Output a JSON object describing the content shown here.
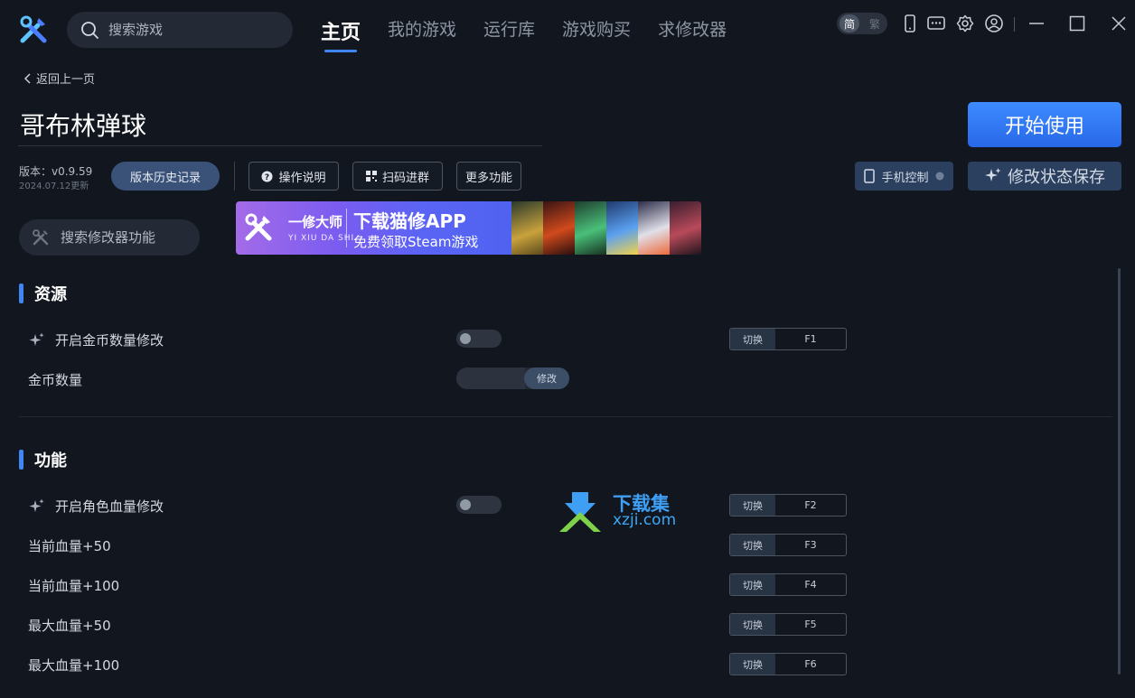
{
  "topbar": {
    "search_placeholder": "搜索游戏",
    "tabs": [
      {
        "label": "主页",
        "active": true
      },
      {
        "label": "我的游戏",
        "active": false
      },
      {
        "label": "运行库",
        "active": false
      },
      {
        "label": "游戏购买",
        "active": false
      },
      {
        "label": "求修改器",
        "active": false
      }
    ],
    "lang_active": "简",
    "lang_inactive": "繁"
  },
  "header": {
    "back_label": "返回上一页",
    "game_title": "哥布林弹球",
    "start_label": "开始使用",
    "version": "版本：v0.9.59",
    "updated": "2024.07.12更新",
    "history_label": "版本历史记录",
    "instructions_label": "操作说明",
    "qr_label": "扫码进群",
    "more_label": "更多功能",
    "mobile_label": "手机控制",
    "save_label": "修改状态保存"
  },
  "func_search_placeholder": "搜索修改器功能",
  "banner": {
    "brand": "一修大师",
    "brand_sub": "YI XIU DA SHI",
    "title": "下载猫修APP",
    "subtitle": "免费领取Steam游戏"
  },
  "sections": [
    {
      "title": "资源",
      "rows": [
        {
          "label": "开启金币数量修改",
          "control": "toggle",
          "toggle_on": false,
          "hotkey_mode": "切换",
          "hotkey": "F1"
        },
        {
          "label": "金币数量",
          "control": "slider",
          "button": "修改"
        }
      ]
    },
    {
      "title": "功能",
      "rows": [
        {
          "label": "开启角色血量修改",
          "control": "toggle",
          "toggle_on": false,
          "hotkey_mode": "切换",
          "hotkey": "F2"
        },
        {
          "label": "当前血量+50",
          "hotkey_mode": "切换",
          "hotkey": "F3"
        },
        {
          "label": "当前血量+100",
          "hotkey_mode": "切换",
          "hotkey": "F4"
        },
        {
          "label": "最大血量+50",
          "hotkey_mode": "切换",
          "hotkey": "F5"
        },
        {
          "label": "最大血量+100",
          "hotkey_mode": "切换",
          "hotkey": "F6"
        }
      ]
    }
  ],
  "watermark": {
    "line1": "下载集",
    "line2": "xzji.com"
  },
  "colors": {
    "background": "#12171f",
    "accent": "#3f86f3",
    "start_button": "#2f78f0"
  }
}
